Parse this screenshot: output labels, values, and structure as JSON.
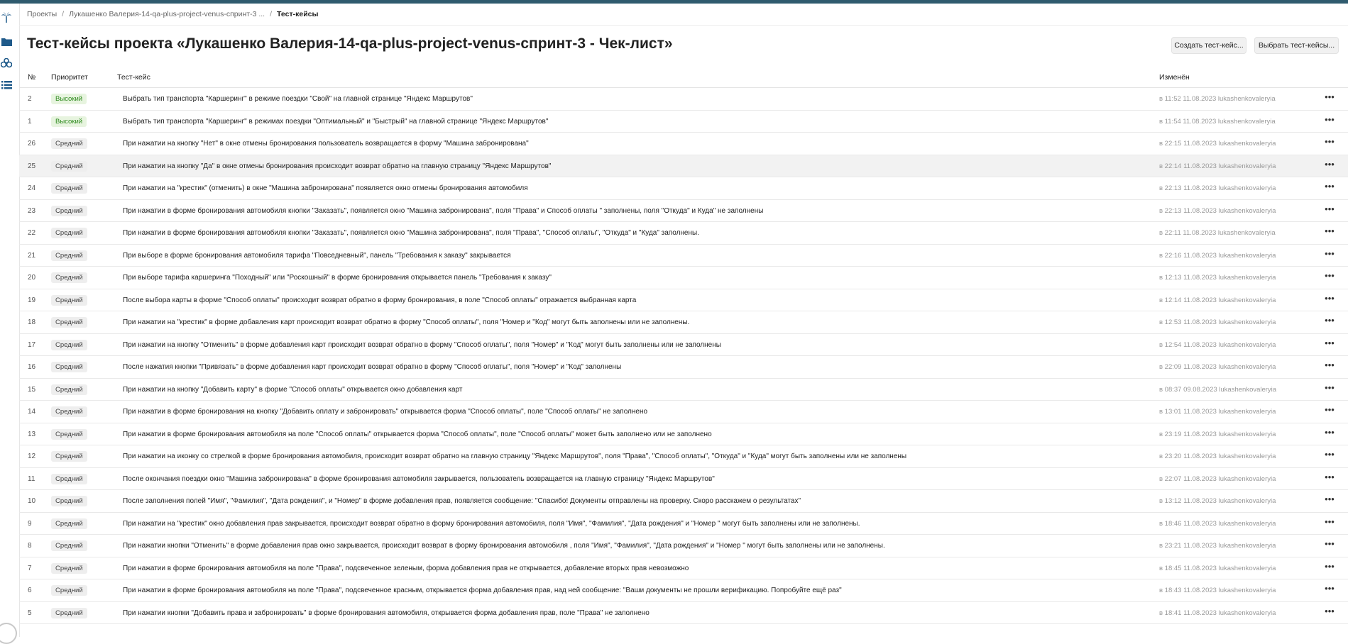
{
  "breadcrumb": {
    "projects": "Проекты",
    "project": "Лукашенко Валерия-14-qa-plus-project-venus-спринт-3 ...",
    "current": "Тест-кейсы"
  },
  "page_title": "Тест-кейсы проекта «Лукашенко Валерия-14-qa-plus-project-venus-спринт-3 - Чек-лист»",
  "buttons": {
    "create": "Создать тест-кейс...",
    "select": "Выбрать тест-кейсы..."
  },
  "table": {
    "headers": {
      "num": "№",
      "priority": "Приоритет",
      "test_case": "Тест-кейс",
      "changed": "Изменён"
    },
    "rows": [
      {
        "num": "2",
        "priority": "Высокий",
        "name": "Выбрать тип транспорта \"Каршеринг\" в режиме поездки \"Свой\" на главной странице \"Яндекс Маршрутов\"",
        "changed": "в 11:52 11.08.2023 lukashenkovaleryia"
      },
      {
        "num": "1",
        "priority": "Высокий",
        "name": "Выбрать тип транспорта \"Каршеринг\" в режимах поездки \"Оптимальный\" и \"Быстрый\" на главной странице \"Яндекс Маршрутов\"",
        "changed": "в 11:54 11.08.2023 lukashenkovaleryia"
      },
      {
        "num": "26",
        "priority": "Средний",
        "name": "При нажатии на кнопку \"Нет\" в окне отмены бронирования пользователь возвращается в форму \"Машина забронирована\"",
        "changed": "в 22:15 11.08.2023 lukashenkovaleryia"
      },
      {
        "num": "25",
        "priority": "Средний",
        "name": "При нажатии на кнопку \"Да\" в окне отмены бронирования происходит возврат обратно на главную страницу \"Яндекс Маршрутов\"",
        "changed": "в 22:14 11.08.2023 lukashenkovaleryia"
      },
      {
        "num": "24",
        "priority": "Средний",
        "name": "При нажатии на \"крестик\" (отменить) в окне \"Машина забронирована\" появляется окно отмены бронирования автомобиля",
        "changed": "в 22:13 11.08.2023 lukashenkovaleryia"
      },
      {
        "num": "23",
        "priority": "Средний",
        "name": "При нажатии в форме бронирования автомобиля кнопки \"Заказать\", появляется окно \"Машина забронирована\", поля \"Права\" и Способ оплаты \" заполнены, поля \"Откуда\" и Куда\" не заполнены",
        "changed": "в 22:13 11.08.2023 lukashenkovaleryia"
      },
      {
        "num": "22",
        "priority": "Средний",
        "name": "При нажатии в форме бронирования автомобиля кнопки \"Заказать\", появляется окно \"Машина забронирована\", поля \"Права\", \"Способ оплаты\", \"Откуда\" и \"Куда\" заполнены.",
        "changed": "в 22:11 11.08.2023 lukashenkovaleryia"
      },
      {
        "num": "21",
        "priority": "Средний",
        "name": "При выборе в форме бронирования автомобиля тарифа \"Повседневный\", панель \"Требования к заказу\" закрывается",
        "changed": "в 22:16 11.08.2023 lukashenkovaleryia"
      },
      {
        "num": "20",
        "priority": "Средний",
        "name": "При выборе тарифа каршеринга \"Походный\" или \"Роскошный\" в форме бронирования открывается панель \"Требования к заказу\"",
        "changed": "в 12:13 11.08.2023 lukashenkovaleryia"
      },
      {
        "num": "19",
        "priority": "Средний",
        "name": "После выбора карты в форме \"Способ оплаты\" происходит возврат обратно в форму бронирования, в поле \"Способ оплаты\" отражается выбранная карта",
        "changed": "в 12:14 11.08.2023 lukashenkovaleryia"
      },
      {
        "num": "18",
        "priority": "Средний",
        "name": "При нажатии на \"крестик\" в форме добавления карт происходит возврат обратно в форму \"Способ оплаты\", поля \"Номер и \"Код\" могут быть заполнены или не заполнены.",
        "changed": "в 12:53 11.08.2023 lukashenkovaleryia"
      },
      {
        "num": "17",
        "priority": "Средний",
        "name": "При нажатии на кнопку \"Отменить\" в форме добавления карт происходит возврат обратно в форму \"Способ оплаты\", поля \"Номер\" и \"Код\" могут быть заполнены или не заполнены",
        "changed": "в 12:54 11.08.2023 lukashenkovaleryia"
      },
      {
        "num": "16",
        "priority": "Средний",
        "name": "После нажатия кнопки \"Привязать\" в форме добавления карт происходит возврат обратно в форму \"Способ оплаты\", поля \"Номер\" и \"Код\" заполнены",
        "changed": "в 22:09 11.08.2023 lukashenkovaleryia"
      },
      {
        "num": "15",
        "priority": "Средний",
        "name": "При нажатии на кнопку \"Добавить карту\" в форме \"Способ оплаты\" открывается окно добавления карт",
        "changed": "в 08:37 09.08.2023 lukashenkovaleryia"
      },
      {
        "num": "14",
        "priority": "Средний",
        "name": "При нажатии в форме бронирования на кнопку \"Добавить оплату и забронировать\" открывается форма \"Способ оплаты\", поле \"Способ оплаты\" не заполнено",
        "changed": "в 13:01 11.08.2023 lukashenkovaleryia"
      },
      {
        "num": "13",
        "priority": "Средний",
        "name": "При нажатии в форме бронирования автомобиля на поле \"Способ оплаты\" открывается форма \"Способ оплаты\", поле \"Способ оплаты\" может быть заполнено или не заполнено",
        "changed": "в 23:19 11.08.2023 lukashenkovaleryia"
      },
      {
        "num": "12",
        "priority": "Средний",
        "name": "При нажатии на иконку со стрелкой в форме бронирования автомобиля, происходит возврат обратно на главную страницу \"Яндекс Маршрутов\", поля \"Права\", \"Способ оплаты\", \"Откуда\" и \"Куда\" могут быть заполнены или не заполнены",
        "changed": "в 23:20 11.08.2023 lukashenkovaleryia"
      },
      {
        "num": "11",
        "priority": "Средний",
        "name": "После окончания поездки окно \"Машина забронирована\" в форме бронирования автомобиля закрывается, пользователь возвращается на главную страницу \"Яндекс Маршрутов\"",
        "changed": "в 22:07 11.08.2023 lukashenkovaleryia"
      },
      {
        "num": "10",
        "priority": "Средний",
        "name": "После заполнения полей \"Имя\", \"Фамилия\", \"Дата рождения\", и \"Номер\" в форме добавления прав, появляется сообщение: \"Спасибо! Документы отправлены на проверку. Скоро расскажем о результатах\"",
        "changed": "в 13:12 11.08.2023 lukashenkovaleryia"
      },
      {
        "num": "9",
        "priority": "Средний",
        "name": "При нажатии на \"крестик\" окно добавления прав закрывается, происходит возврат обратно в форму бронирования автомобиля, поля \"Имя\", \"Фамилия\", \"Дата рождения\" и \"Номер \" могут быть заполнены или не заполнены.",
        "changed": "в 18:46 11.08.2023 lukashenkovaleryia"
      },
      {
        "num": "8",
        "priority": "Средний",
        "name": "При нажатии кнопки \"Отменить\" в форме добавления прав окно закрывается, происходит возврат в форму бронирования автомобиля , поля \"Имя\", \"Фамилия\", \"Дата рождения\" и \"Номер \" могут быть заполнены или не заполнены.",
        "changed": "в 23:21 11.08.2023 lukashenkovaleryia"
      },
      {
        "num": "7",
        "priority": "Средний",
        "name": "При нажатии в форме бронирования автомобиля на поле \"Права\", подсвеченное зеленым, форма добавления прав не открывается, добавление вторых прав невозможно",
        "changed": "в 18:45 11.08.2023 lukashenkovaleryia"
      },
      {
        "num": "6",
        "priority": "Средний",
        "name": "При нажатии в форме бронирования автомобиля на поле \"Права\", подсвеченное красным, открывается форма добавления прав, над ней сообщение: \"Ваши документы не прошли верификацию. Попробуйте ещё раз\"",
        "changed": "в 18:43 11.08.2023 lukashenkovaleryia"
      },
      {
        "num": "5",
        "priority": "Средний",
        "name": "При нажатии кнопки \"Добавить права и забронировать\" в форме бронирования автомобиля, открывается форма добавления прав, поле \"Права\" не заполнено",
        "changed": "в 18:41 11.08.2023 lukashenkovaleryia"
      }
    ]
  },
  "colors": {
    "accent": "#2f5b6e",
    "high_bg": "#e7f4df",
    "high_text": "#2e8a1e",
    "row_highlight": "#f2f2f2"
  },
  "icons": [
    "palm-logo-icon",
    "folder-icon",
    "bicycle-icon",
    "list-icon",
    "more-icon"
  ]
}
